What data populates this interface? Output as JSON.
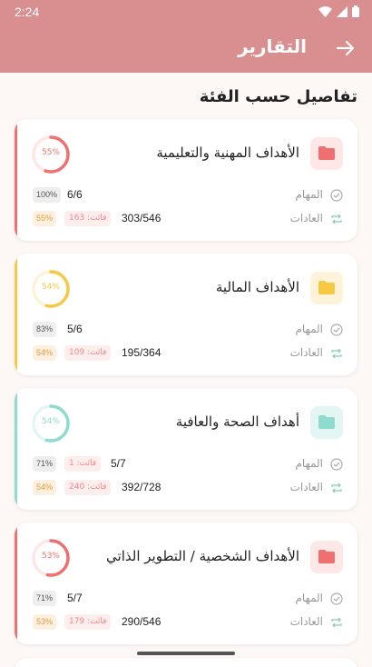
{
  "status": {
    "time": "2:24"
  },
  "appbar": {
    "title": "التقارير"
  },
  "section_title": "تفاصيل حسب الفئة",
  "labels": {
    "tasks": "المهام",
    "habits": "العادات"
  },
  "categories": [
    {
      "name": "الأهداف المهنية والتعليمية",
      "color": "#f07070",
      "progress_label": "55%",
      "progress": 0.55,
      "tasks_count": "6/6",
      "tasks_pct": "100%",
      "tasks_missed": "",
      "habits_count": "303/546",
      "habits_pct": "55%",
      "habits_missed": "فائت: 163"
    },
    {
      "name": "الأهداف المالية",
      "color": "#f6c843",
      "progress_label": "54%",
      "progress": 0.54,
      "tasks_count": "5/6",
      "tasks_pct": "83%",
      "tasks_missed": "",
      "habits_count": "195/364",
      "habits_pct": "54%",
      "habits_missed": "فائت: 109"
    },
    {
      "name": "أهداف الصحة والعافية",
      "color": "#8edbd0",
      "progress_label": "54%",
      "progress": 0.54,
      "tasks_count": "5/7",
      "tasks_pct": "71%",
      "tasks_missed": "فائت: 1",
      "habits_count": "392/728",
      "habits_pct": "54%",
      "habits_missed": "فائت: 240"
    },
    {
      "name": "الأهداف الشخصية / التطوير الذاتي",
      "color": "#f07070",
      "progress_label": "53%",
      "progress": 0.53,
      "tasks_count": "5/7",
      "tasks_pct": "71%",
      "tasks_missed": "",
      "habits_count": "290/546",
      "habits_pct": "53%",
      "habits_missed": "فائت: 179"
    }
  ],
  "icons": {
    "back": "arrow-right-icon",
    "folder": "folder-icon",
    "task": "check-circle-icon",
    "habit": "repeat-icon",
    "wifi": "wifi-icon",
    "signal": "signal-icon",
    "battery": "battery-icon"
  }
}
